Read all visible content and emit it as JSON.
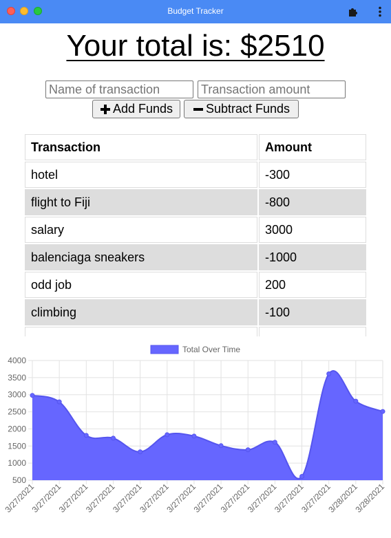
{
  "window": {
    "title": "Budget Tracker"
  },
  "header": {
    "total_text": "Your total is: $2510"
  },
  "form": {
    "name_placeholder": "Name of transaction",
    "amount_placeholder": "Transaction amount",
    "add_label": "Add Funds",
    "subtract_label": "Subtract Funds"
  },
  "table": {
    "headers": [
      "Transaction",
      "Amount"
    ],
    "rows": [
      {
        "name": "hotel",
        "amount": "-300"
      },
      {
        "name": "flight to Fiji",
        "amount": "-800"
      },
      {
        "name": "salary",
        "amount": "3000"
      },
      {
        "name": "balenciaga sneakers",
        "amount": "-1000"
      },
      {
        "name": "odd job",
        "amount": "200"
      },
      {
        "name": "climbing",
        "amount": "-100"
      },
      {
        "name": "",
        "amount": ""
      }
    ]
  },
  "colors": {
    "titlebar": "#4a8af4",
    "series_fill": "#6666ff",
    "series_line": "#5555ee",
    "row_alt": "#dddddd"
  },
  "icons": {
    "extension": "puzzle-icon",
    "menu": "kebab-menu-icon",
    "add": "plus-icon",
    "subtract": "minus-icon"
  },
  "chart_data": {
    "type": "area",
    "legend": {
      "label": "Total Over Time",
      "position": "top"
    },
    "ylim": [
      500,
      4000
    ],
    "yticks": [
      4000,
      3500,
      3000,
      2500,
      2000,
      1500,
      1000,
      500
    ],
    "grid": true,
    "categories": [
      "3/27/2021",
      "3/27/2021",
      "3/27/2021",
      "3/27/2021",
      "3/27/2021",
      "3/27/2021",
      "3/27/2021",
      "3/27/2021",
      "3/27/2021",
      "3/27/2021",
      "3/27/2021",
      "3/27/2021",
      "3/28/2021",
      "3/28/2021"
    ],
    "series": [
      {
        "name": "Total Over Time",
        "values": [
          2980,
          2790,
          1810,
          1730,
          1330,
          1830,
          1790,
          1510,
          1390,
          1610,
          610,
          3610,
          2810,
          2510
        ]
      }
    ]
  }
}
